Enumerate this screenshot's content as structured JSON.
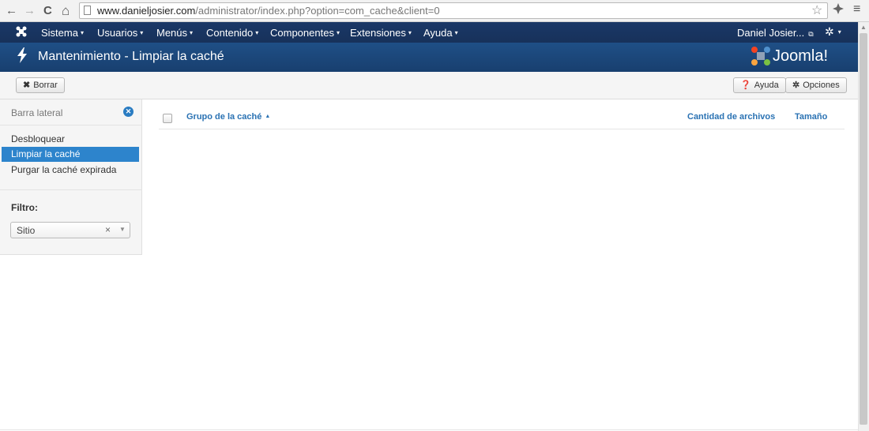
{
  "browser": {
    "url_host": "www.danieljosier.com",
    "url_path": "/administrator/index.php?option=com_cache&client=0",
    "back_icon": "←",
    "forward_icon": "→",
    "reload_icon": "C",
    "home_icon": "⌂",
    "star_icon": "☆",
    "menu_icon": "≡"
  },
  "navbar": {
    "items": [
      {
        "label": "Sistema"
      },
      {
        "label": "Usuarios"
      },
      {
        "label": "Menús"
      },
      {
        "label": "Contenido"
      },
      {
        "label": "Componentes"
      },
      {
        "label": "Extensiones"
      },
      {
        "label": "Ayuda"
      }
    ],
    "user": "Daniel Josier...",
    "caret": "▾"
  },
  "header": {
    "title": "Mantenimiento - Limpiar la caché",
    "brand": "Joomla!"
  },
  "toolbar": {
    "clear_label": "Borrar",
    "help_label": "Ayuda",
    "options_label": "Opciones"
  },
  "sidebar": {
    "heading": "Barra lateral",
    "links": [
      "Desbloquear",
      "Limpiar la caché",
      "Purgar la caché expirada"
    ],
    "filter_label": "Filtro:",
    "filter_value": "Sitio"
  },
  "table": {
    "col_group": "Grupo de la caché",
    "col_count": "Cantidad de archivos",
    "col_size": "Tamaño"
  },
  "colors": {
    "navbar": "#17315a",
    "header": "#1f4f86",
    "accent": "#2d84cc",
    "link": "#2a72b3"
  }
}
